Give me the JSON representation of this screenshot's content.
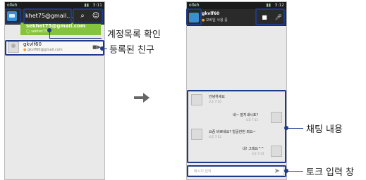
{
  "left_phone": {
    "status_carrier": "olleh",
    "status_time": "3:11",
    "account_label": "khet75@gmail....",
    "account_dropdown": {
      "email": "sekhet75@gmail.com",
      "sub": "sekhet75"
    },
    "contact": {
      "name": "gkvlf60",
      "status": "gkvlf60@gmail.com"
    }
  },
  "right_phone": {
    "status_carrier": "olleh",
    "status_time": "3:12",
    "header_title": "gkvlf60",
    "header_sub": "모바일 사용 중",
    "messages": [
      {
        "text": "안녕하세요",
        "time": "오후 7:10",
        "side": "left"
      },
      {
        "text": "네~ 잘지내시죠?",
        "time": "오후 7:11",
        "side": "right"
      },
      {
        "text": "요즘 바쁘세요? 얼굴한번 뵈요~",
        "time": "오후 7:13",
        "side": "left"
      },
      {
        "text": "네! 그래요^^",
        "time": "오후 7:14",
        "side": "right"
      }
    ],
    "input_placeholder": "메시지 입력"
  },
  "callouts": {
    "account_check": "계정목록 확인",
    "registered_friend": "등록된 친구",
    "chat_content": "채팅 내용",
    "talk_input": "토크 입력 창"
  },
  "colors": {
    "highlight": "#1e3a8a",
    "account_bar": "#86c33c",
    "app_icon": "#3b8fd1"
  }
}
